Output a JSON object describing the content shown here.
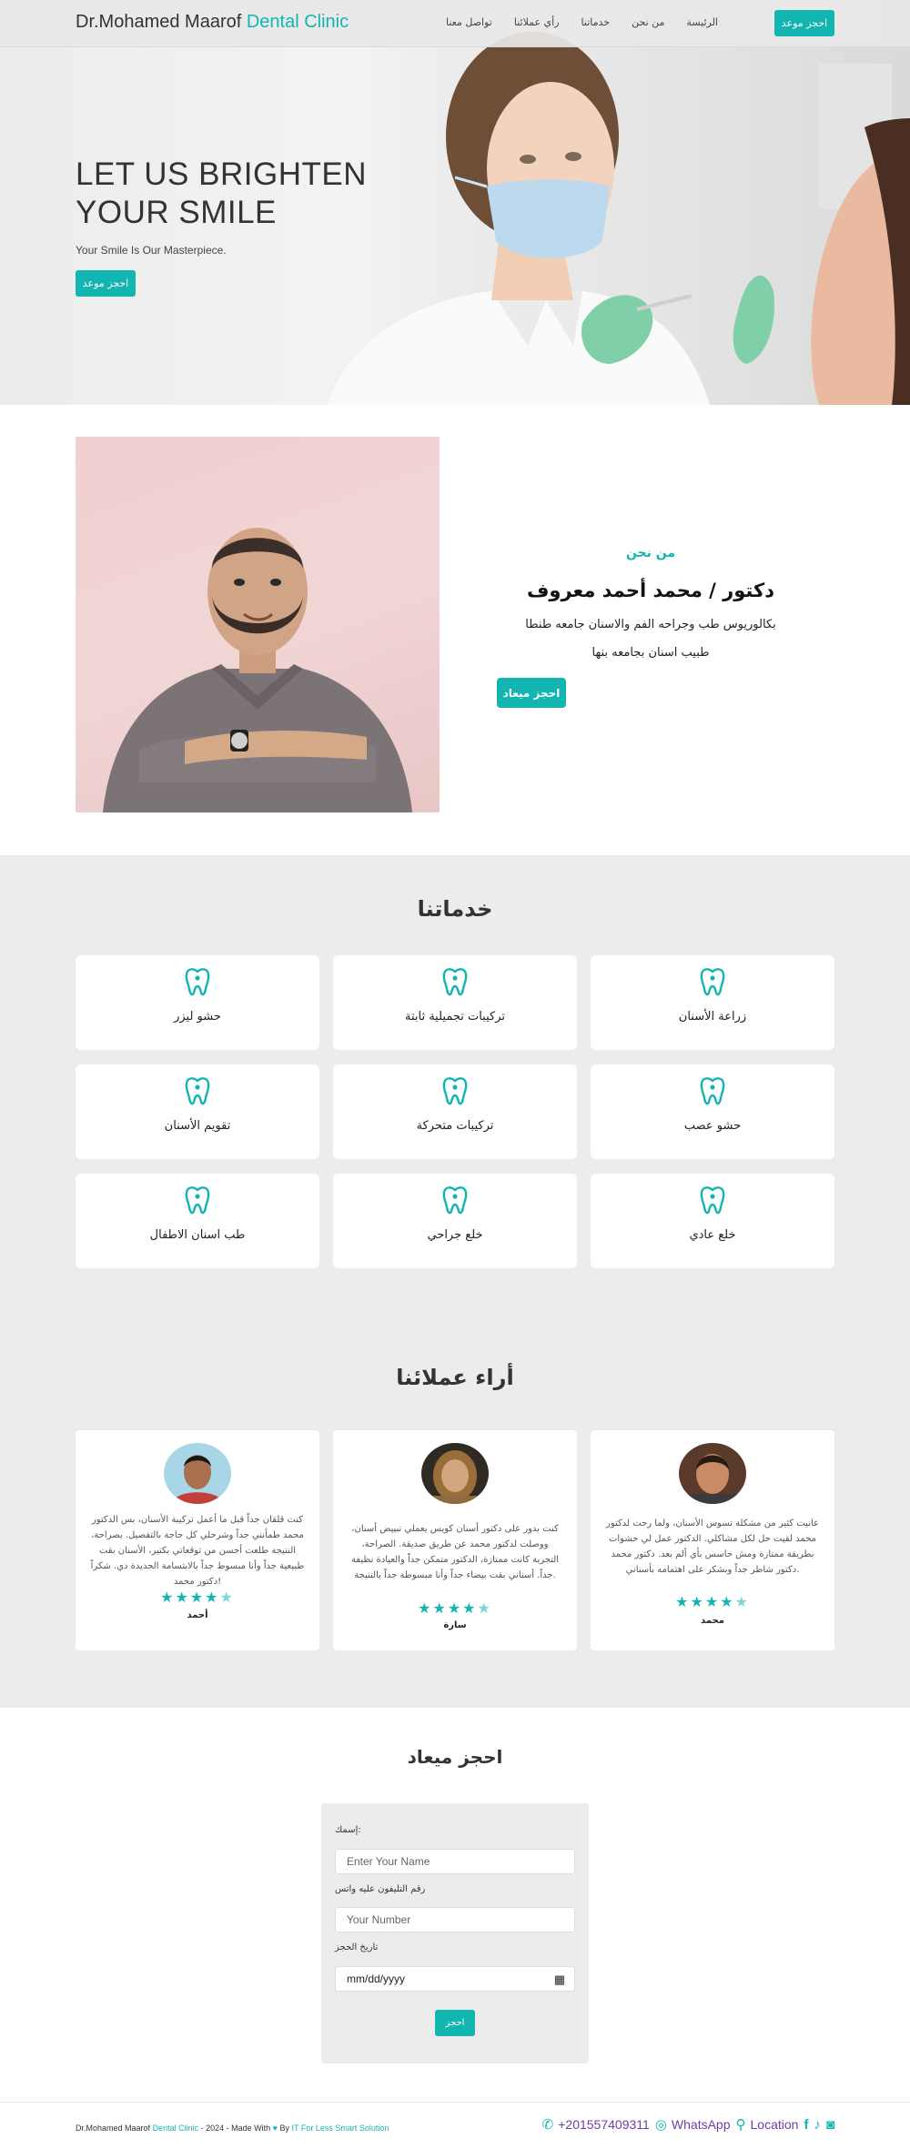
{
  "nav": {
    "brand_main": "Dr.Mohamed Maarof",
    "brand_accent": "Dental Clinic",
    "links": [
      "الرئيسة",
      "من نحن",
      "خدماتنا",
      "رأي عملائنا",
      "تواصل معنا"
    ],
    "cta": "احجز موعد"
  },
  "hero": {
    "title_line1": "LET US BRIGHTEN",
    "title_line2": "YOUR SMILE",
    "subtitle": "Your Smile Is Our Masterpiece.",
    "cta": "احجز موعد"
  },
  "about": {
    "kicker": "من نحن",
    "name": "دكتور / محمد أحمد معروف",
    "line1": "بكالوريوس طب وجراحه الفم والاسنان جامعه طنطا",
    "line2": "طبيب اسنان بجامعه بنها",
    "cta": "احجز ميعاد"
  },
  "services": {
    "title": "خدماتنا",
    "items": [
      {
        "label": "زراعة الأسنان"
      },
      {
        "label": "تركيبات تجميلية ثابتة"
      },
      {
        "label": "حشو ليزر"
      },
      {
        "label": "حشو عصب"
      },
      {
        "label": "تركيبات متحركة"
      },
      {
        "label": "تقويم الأسنان"
      },
      {
        "label": "خلع عادي"
      },
      {
        "label": "خلع جراحي"
      },
      {
        "label": "طب اسنان الاطفال"
      }
    ]
  },
  "testimonials": {
    "title": "أراء عملائنا",
    "items": [
      {
        "name": "محمد",
        "rating": 4.5,
        "quote": "عانيت كثير من مشكلة تسوس الأسنان، ولما رحت لدكتور محمد لقيت حل لكل مشاكلي. الدكتور عمل لي حشوات بطريقة ممتازة ومش حاسس بأي ألم بعد. دكتور محمد دكتور شاطر جداً وبشكر على اهتمامه بأسناني."
      },
      {
        "name": "سارة",
        "rating": 4.5,
        "quote": "كنت بدور على دكتور أسنان كويس يعملي تبييض أسنان، ووصلت لدكتور محمد عن طريق صديقة. الصراحة، التجربة كانت ممتازة، الدكتور متمكن جداً والعيادة نظيفة جداً. أسناني بقت بيضاء جداً وأنا مبسوطة جداً بالنتيجة."
      },
      {
        "name": "أحمد",
        "rating": 4.5,
        "quote": "كنت قلقان جداً قبل ما أعمل تركيبة الأسنان، بس الدكتور محمد طمأنني جداً وشرحلي كل حاجة بالتفصيل. بصراحة، النتيجة طلعت أحسن من توقعاتي بكتير، الأسنان بقت طبيعية جداً وأنا مبسوط جداً بالابتسامة الجديدة دي. شكراً دكتور محمد!"
      }
    ]
  },
  "booking": {
    "title": "احجز ميعاد",
    "name_label": "إسمك:",
    "name_placeholder": "Enter Your Name",
    "phone_label": "رقم التليفون عليه واتس",
    "phone_placeholder": "Your Number",
    "date_label": "تاريخ الحجز",
    "date_placeholder": "mm/dd/yyyy",
    "submit": "احجز"
  },
  "footer": {
    "prefix": "Dr.Mohamed Maarof",
    "accent": "Dental Clinic",
    "year_text": "- 2024 - Made With",
    "by": "By",
    "credit": "IT For Less Smart Solution",
    "phone": "+201557409311",
    "whatsapp": "WhatsApp",
    "location": "Location"
  },
  "colors": {
    "accent": "#12b5b0",
    "section_grey": "#ececec",
    "footer_link": "#6b3fa0"
  }
}
